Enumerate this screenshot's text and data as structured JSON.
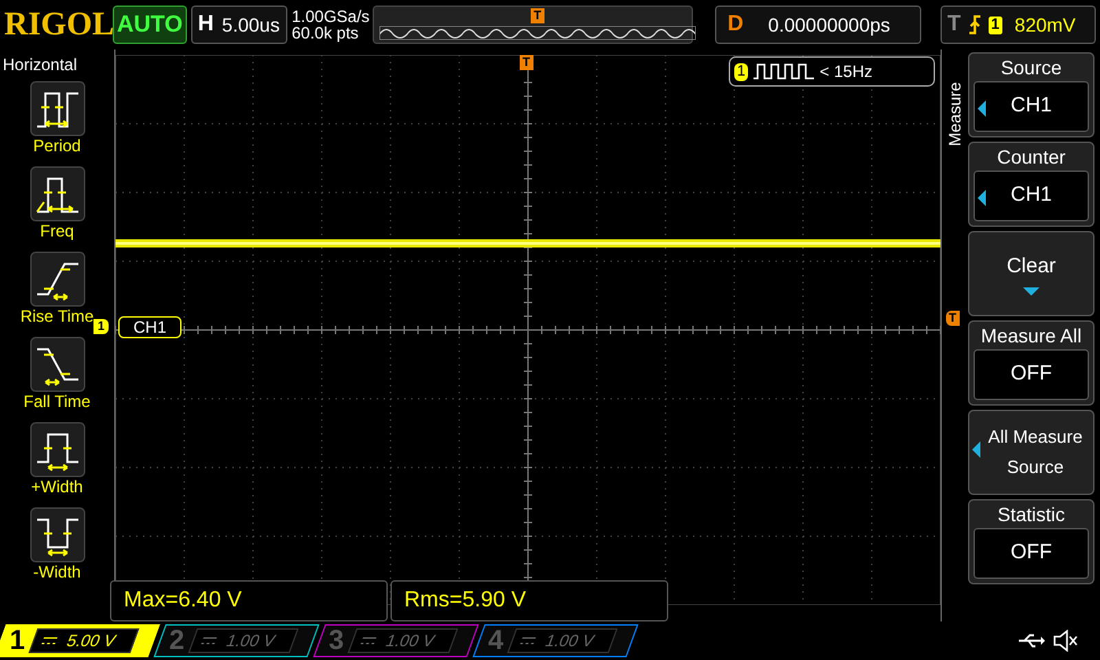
{
  "header": {
    "logo": "RIGOL",
    "trigger_position": "T",
    "run_status": "AUTO",
    "horizontal": {
      "label": "H",
      "timebase": "5.00us"
    },
    "sample_rate": "1.00GSa/s",
    "memory_depth": "60.0k pts",
    "delay": {
      "label": "D",
      "value": "0.00000000ps"
    },
    "trigger": {
      "label": "T",
      "source": "1",
      "level": "820mV"
    }
  },
  "left_menu": {
    "title": "Horizontal",
    "items": [
      {
        "label": "Period",
        "kind": "period"
      },
      {
        "label": "Freq",
        "kind": "freq"
      },
      {
        "label": "Rise Time",
        "kind": "rise"
      },
      {
        "label": "Fall Time",
        "kind": "fall"
      },
      {
        "label": "+Width",
        "kind": "pwidth"
      },
      {
        "label": "-Width",
        "kind": "nwidth"
      }
    ]
  },
  "screen": {
    "trigger_position": "T",
    "channel_marker": "1",
    "channel_label": "CH1",
    "trigger_level_marker": "T",
    "counter": {
      "channel": "1",
      "value": "< 15Hz"
    }
  },
  "right_menu": {
    "title": "Measure",
    "items": [
      {
        "title": "Source",
        "value": "CH1",
        "kind": "select"
      },
      {
        "title": "Counter",
        "value": "CH1",
        "kind": "select"
      },
      {
        "title": "Clear",
        "kind": "dropdown"
      },
      {
        "title": "Measure All",
        "value": "OFF",
        "kind": "value"
      },
      {
        "title": "All Measure Source",
        "kind": "multiline"
      },
      {
        "title": "Statistic",
        "value": "OFF",
        "kind": "value"
      }
    ]
  },
  "measurements": [
    "Max=6.40 V",
    "Rms=5.90 V"
  ],
  "channels": [
    {
      "number": "1",
      "scale": "5.00 V",
      "color": "#ffff00",
      "selected": true
    },
    {
      "number": "2",
      "scale": "1.00 V",
      "color": "#00c0c0",
      "selected": false
    },
    {
      "number": "3",
      "scale": "1.00 V",
      "color": "#c000c0",
      "selected": false
    },
    {
      "number": "4",
      "scale": "1.00 V",
      "color": "#0080ff",
      "selected": false
    }
  ]
}
